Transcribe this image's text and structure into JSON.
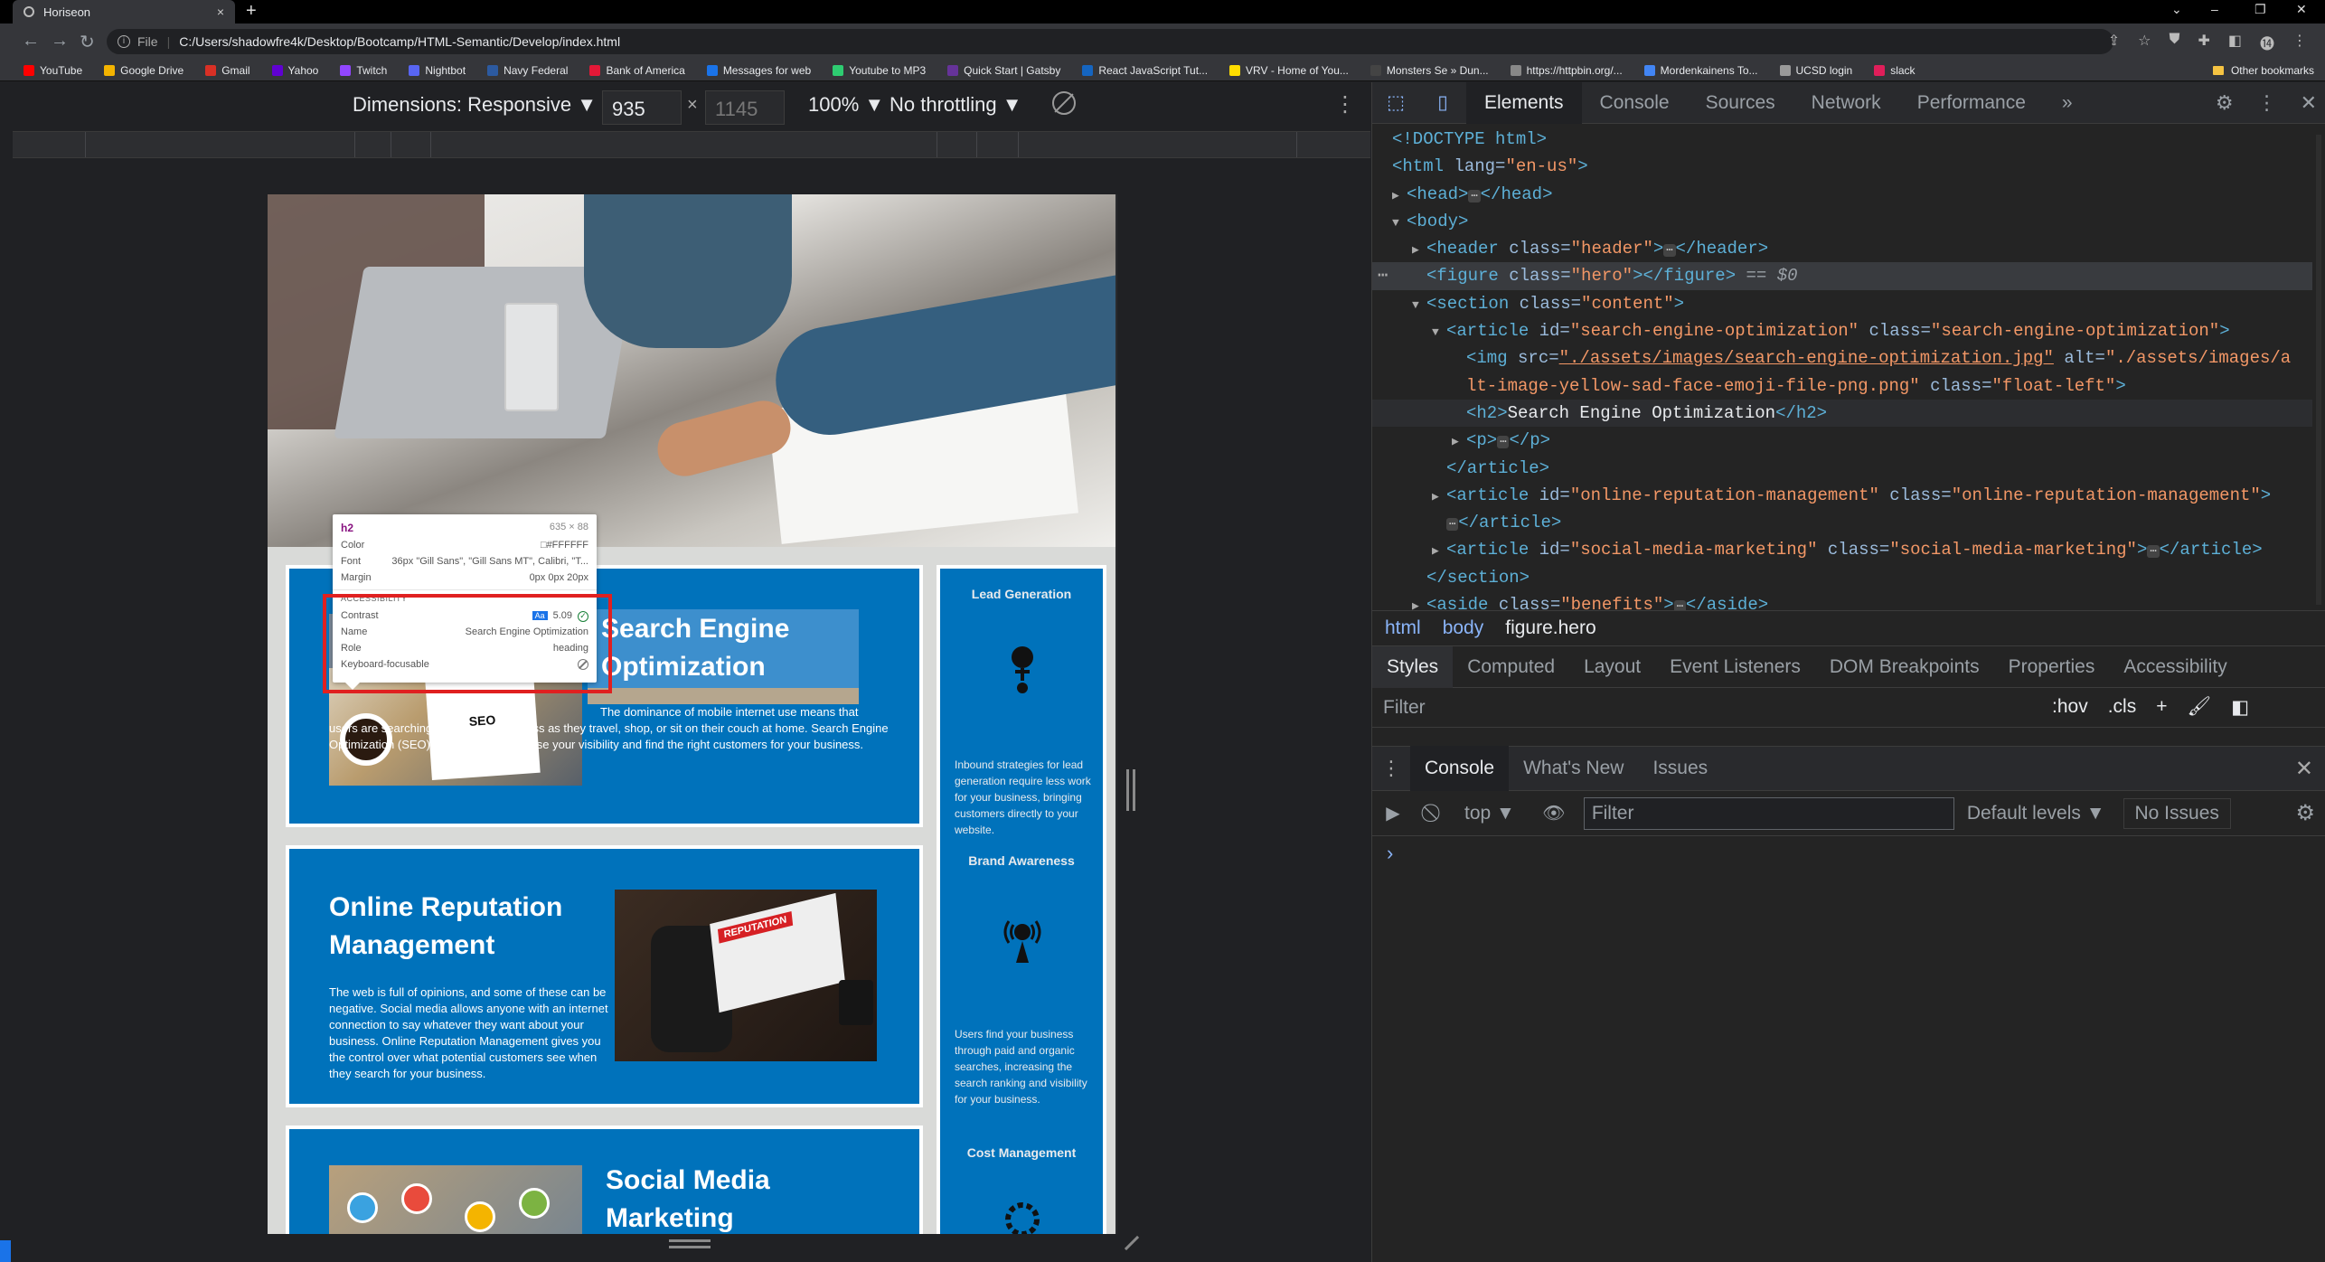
{
  "browser": {
    "tab_title": "Horiseon",
    "tab_close": "×",
    "new_tab": "+",
    "window_controls": [
      "⌄",
      "–",
      "❐",
      "✕"
    ],
    "nav_back": "←",
    "nav_forward": "→",
    "nav_reload": "↻",
    "address_info": "i",
    "address_label": "File",
    "address_sep": "|",
    "address": "C:/Users/shadowfre4k/Desktop/Bootcamp/HTML-Semantic/Develop/index.html",
    "toolbar_icons": [
      "⇪",
      "☆",
      "⛊",
      "✚",
      "◧",
      "⓮",
      "⋮"
    ],
    "bookmarks": [
      {
        "label": "YouTube",
        "color": "#ff0000"
      },
      {
        "label": "Google Drive",
        "color": "#f4b400"
      },
      {
        "label": "Gmail",
        "color": "#d93025"
      },
      {
        "label": "Yahoo",
        "color": "#6001d2"
      },
      {
        "label": "Twitch",
        "color": "#9146ff"
      },
      {
        "label": "Nightbot",
        "color": "#5865f2"
      },
      {
        "label": "Navy Federal",
        "color": "#2c5aa0"
      },
      {
        "label": "Bank of America",
        "color": "#e31837"
      },
      {
        "label": "Messages for web",
        "color": "#1a73e8"
      },
      {
        "label": "Youtube to MP3",
        "color": "#2ecc71"
      },
      {
        "label": "Quick Start | Gatsby",
        "color": "#663399"
      },
      {
        "label": "React JavaScript Tut...",
        "color": "#1565c0"
      },
      {
        "label": "VRV - Home of You...",
        "color": "#ffdd00"
      },
      {
        "label": "Monsters Se » Dun...",
        "color": "#444444"
      },
      {
        "label": "https://httpbin.org/...",
        "color": "#888888"
      },
      {
        "label": "Mordenkainens To...",
        "color": "#4285f4"
      },
      {
        "label": "UCSD login",
        "color": "#999999"
      },
      {
        "label": "slack",
        "color": "#e01e5a"
      }
    ],
    "other_bookmarks": "Other bookmarks"
  },
  "device_toolbar": {
    "dimensions": "Dimensions: Responsive ▼",
    "width": "935",
    "height": "1145",
    "times": "×",
    "zoom": "100% ▼",
    "throttling": "No throttling ▼",
    "menu": "⋮"
  },
  "page": {
    "seo_heading": "Search Engine Optimization",
    "seo_body": "The dominance of mobile internet use means that users are searching for the right business as they travel, shop, or sit on their couch at home. Search Engine Optimization (SEO) allows you to increase your visibility and find the right customers for your business.",
    "seo_note": "SEO",
    "orm_heading": "Online Reputation Management",
    "orm_body": "The web is full of opinions, and some of these can be negative. Social media allows anyone with an internet connection to say whatever they want about your business. Online Reputation Management gives you the control over what potential customers see when they search for your business.",
    "orm_screen": "REPUTATION",
    "smm_heading": "Social Media Marketing",
    "benefits": [
      {
        "title": "Lead Generation",
        "body": "Inbound strategies for lead generation require less work for your business, bringing customers directly to your website."
      },
      {
        "title": "Brand Awareness",
        "body": "Users find your business through paid and organic searches, increasing the search ranking and visibility for your business."
      },
      {
        "title": "Cost Management",
        "body": ""
      }
    ]
  },
  "inspect_tooltip": {
    "tag": "h2",
    "size": "635 × 88",
    "color_label": "Color",
    "color_value": "#FFFFFF",
    "font_label": "Font",
    "font_value": "36px \"Gill Sans\", \"Gill Sans MT\", Calibri, \"T...",
    "margin_label": "Margin",
    "margin_value": "0px 0px 20px",
    "section": "ACCESSIBILITY",
    "contrast_label": "Contrast",
    "contrast_aa": "Aa",
    "contrast_value": "5.09",
    "contrast_check": "✓",
    "name_label": "Name",
    "name_value": "Search Engine Optimization",
    "role_label": "Role",
    "role_value": "heading",
    "kbd_label": "Keyboard-focusable"
  },
  "devtools": {
    "tabs": [
      "Elements",
      "Console",
      "Sources",
      "Network",
      "Performance"
    ],
    "active_tab": "Elements",
    "more_tabs": "»",
    "settings": "⚙",
    "menu": "⋮",
    "close": "✕",
    "dom": {
      "doctype": "<!DOCTYPE html>",
      "html_open": "<html",
      "html_lang_attr": " lang=",
      "html_lang_val": "\"en-us\"",
      "close_angle": ">",
      "head_open": "<head>",
      "head_close": "</head>",
      "body_open": "<body>",
      "header_tag": "<header",
      "header_attr": " class=",
      "header_val": "\"header\"",
      "header_close": "</header>",
      "figure_tag": "<figure",
      "figure_attr": " class=",
      "figure_val": "\"hero\"",
      "figure_close": "></figure>",
      "figure_marker": " == $0",
      "section_tag": "<section",
      "section_attr": " class=",
      "section_val": "\"content\"",
      "art1_tag": "<article",
      "art1_id_attr": " id=",
      "art1_id_val": "\"search-engine-optimization\"",
      "art1_class_attr": " class=",
      "art1_class_val": "\"search-engine-optimization\"",
      "img_tag": "<img",
      "img_src_attr": " src=",
      "img_src_val": "\"./assets/images/search-engine-optimization.jpg\"",
      "img_alt_attr": " alt=",
      "img_alt_val_1": "\"./assets/images/a",
      "img_alt_val_2": "lt-image-yellow-sad-face-emoji-file-png.png\"",
      "img_class_attr": " class=",
      "img_class_val": "\"float-left\"",
      "h2_open": "<h2>",
      "h2_text": "Search Engine Optimization",
      "h2_close": "</h2>",
      "p_open": "<p>",
      "p_close": "</p>",
      "article_close": "</article>",
      "art2_tag": "<article",
      "art2_id_attr": " id=",
      "art2_id_val": "\"online-reputation-management\"",
      "art2_class_attr": " class=",
      "art2_class_val": "\"online-reputation-management\"",
      "art3_tag": "<article",
      "art3_id_attr": " id=",
      "art3_id_val": "\"social-media-marketing\"",
      "art3_class_attr": " class=",
      "art3_class_val": "\"social-media-marketing\"",
      "section_close": "</section>",
      "aside_tag": "<aside",
      "aside_attr": " class=",
      "aside_val": "\"benefits\"",
      "aside_close": "</aside>",
      "ellipsis": "⋯",
      "expanded": "▼",
      "collapsed": "▶",
      "gutter_dots": "⋯"
    },
    "breadcrumbs": [
      "html",
      "body",
      "figure.hero"
    ],
    "styles_tabs": [
      "Styles",
      "Computed",
      "Layout",
      "Event Listeners",
      "DOM Breakpoints",
      "Properties",
      "Accessibility"
    ],
    "styles_filter": "Filter",
    "styles_tools": [
      ":hov",
      ".cls",
      "+",
      "🖌",
      "◧"
    ],
    "drawer_tabs": [
      "Console",
      "What's New",
      "Issues"
    ],
    "drawer_menu": "⋮",
    "drawer_close": "✕",
    "console_icons": [
      "▶",
      "⃠",
      "👁",
      "⚙"
    ],
    "console_context": "top ▼",
    "console_filter": "Filter",
    "console_levels": "Default levels ▼",
    "console_issues": "No Issues",
    "console_prompt": "›"
  }
}
